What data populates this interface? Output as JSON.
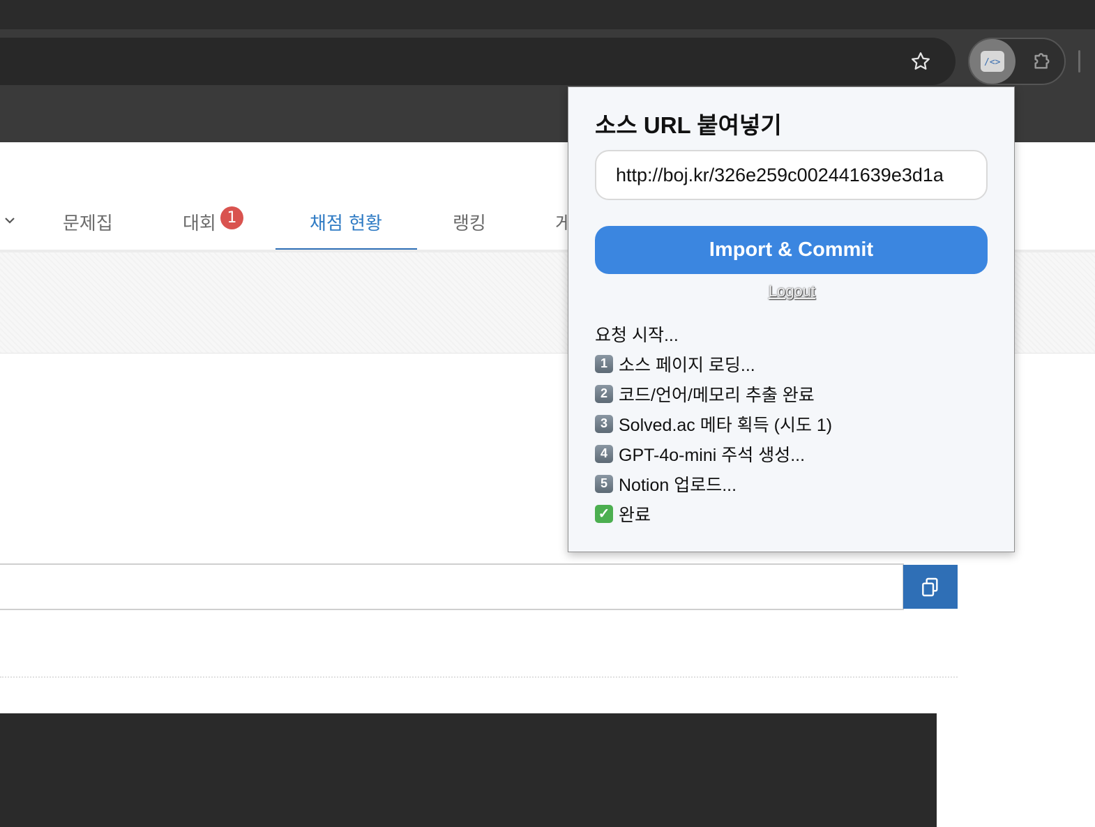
{
  "browser": {
    "star_icon": "star-icon",
    "extension_icon": "code-extension-icon",
    "puzzle_icon": "puzzle-icon"
  },
  "nav": {
    "items": [
      {
        "label": "문제집"
      },
      {
        "label": "대회",
        "badge": "1"
      },
      {
        "label": "채점 현황",
        "active": true
      },
      {
        "label": "랭킹"
      },
      {
        "label": "게"
      }
    ],
    "accent_color": "#2f7bc4"
  },
  "popup": {
    "title": "소스 URL 붙여넣기",
    "url_value": "http://boj.kr/326e259c002441639e3d1a",
    "import_label": "Import & Commit",
    "logout_label": "Logout",
    "log": [
      {
        "prefix": "",
        "text": "요청 시작..."
      },
      {
        "prefix": "1",
        "text": "소스 페이지 로딩..."
      },
      {
        "prefix": "2",
        "text": "코드/언어/메모리 추출 완료"
      },
      {
        "prefix": "3",
        "text": "Solved.ac 메타 획득 (시도 1)"
      },
      {
        "prefix": "4",
        "text": "GPT-4o-mini 주석 생성..."
      },
      {
        "prefix": "5",
        "text": "Notion 업로드..."
      },
      {
        "prefix": "✓",
        "text": "완료"
      }
    ],
    "button_color": "#3b86e0"
  }
}
